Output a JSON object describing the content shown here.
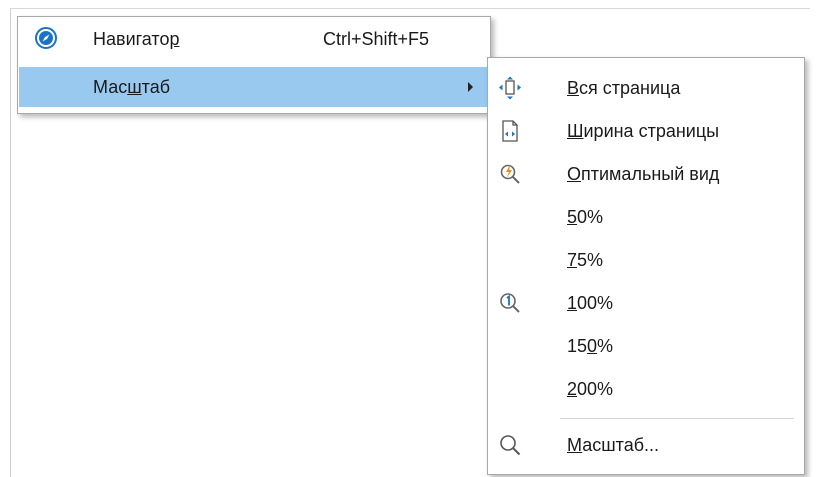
{
  "main_menu": {
    "items": [
      {
        "pre": "Навигато",
        "key": "р",
        "post": "",
        "shortcut": "Ctrl+Shift+F5",
        "icon": "navigator-compass-icon"
      },
      {
        "pre": "Мас",
        "key": "ш",
        "post": "таб",
        "shortcut": "",
        "icon": "",
        "has_submenu": true,
        "highlighted": true
      }
    ]
  },
  "zoom_submenu": {
    "items": [
      {
        "pre": "",
        "key": "В",
        "post": "ся страница",
        "icon": "entire-page-icon"
      },
      {
        "pre": "",
        "key": "Ш",
        "post": "ирина страницы",
        "icon": "page-width-icon"
      },
      {
        "pre": "",
        "key": "О",
        "post": "птимальный вид",
        "icon": "optimal-view-icon"
      },
      {
        "pre": "",
        "key": "5",
        "post": "0%",
        "icon": ""
      },
      {
        "pre": "",
        "key": "7",
        "post": "5%",
        "icon": ""
      },
      {
        "pre": "",
        "key": "1",
        "post": "00%",
        "icon": "zoom-100-icon"
      },
      {
        "pre": "15",
        "key": "0",
        "post": "%",
        "icon": ""
      },
      {
        "pre": "",
        "key": "2",
        "post": "00%",
        "icon": ""
      },
      {
        "pre": "",
        "key": "М",
        "post": "асштаб...",
        "icon": "zoom-search-icon"
      }
    ]
  },
  "colors": {
    "highlight": "#99c9ef",
    "accent_blue": "#1a73c7",
    "accent_orange": "#e58a1f"
  }
}
